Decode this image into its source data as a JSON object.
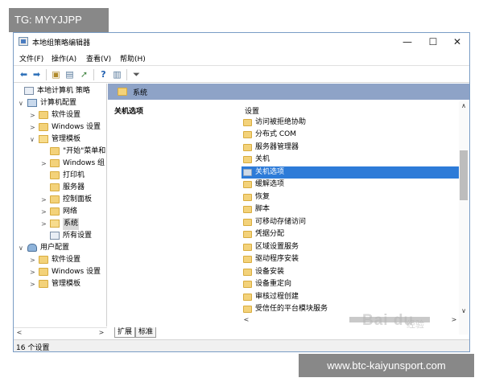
{
  "overlay": {
    "tg_label": "TG: MYYJJPP",
    "url_label": "www.btc-kaiyunsport.com",
    "baidu_mark": "Bai du",
    "baidu_sub": "经验"
  },
  "window": {
    "title": "本地组策略编辑器",
    "controls": {
      "minimize": "—",
      "maximize": "☐",
      "close": "✕"
    }
  },
  "menu": [
    "文件(F)",
    "操作(A)",
    "查看(V)",
    "帮助(H)"
  ],
  "tree": [
    {
      "label": "本地计算机 策略",
      "icon": "policy-icon",
      "arrow": ""
    },
    {
      "label": "计算机配置",
      "icon": "computer-icon",
      "arrow": "∨"
    },
    {
      "label": "软件设置",
      "icon": "folder-icon",
      "arrow": ">"
    },
    {
      "label": "Windows 设置",
      "icon": "folder-icon",
      "arrow": ">"
    },
    {
      "label": "管理模板",
      "icon": "folder-icon",
      "arrow": "∨"
    },
    {
      "label": "\"开始\"菜单和",
      "icon": "folder-icon",
      "arrow": ""
    },
    {
      "label": "Windows 组",
      "icon": "folder-icon",
      "arrow": ">"
    },
    {
      "label": "打印机",
      "icon": "folder-icon",
      "arrow": ""
    },
    {
      "label": "服务器",
      "icon": "folder-icon",
      "arrow": ""
    },
    {
      "label": "控制面板",
      "icon": "folder-icon",
      "arrow": ">"
    },
    {
      "label": "网络",
      "icon": "folder-icon",
      "arrow": ">"
    },
    {
      "label": "系统",
      "icon": "folder-open-icon",
      "arrow": ">"
    },
    {
      "label": "所有设置",
      "icon": "policy-icon",
      "arrow": ""
    },
    {
      "label": "用户配置",
      "icon": "user-icon",
      "arrow": "∨"
    },
    {
      "label": "软件设置",
      "icon": "folder-icon",
      "arrow": ">"
    },
    {
      "label": "Windows 设置",
      "icon": "folder-icon",
      "arrow": ">"
    },
    {
      "label": "管理模板",
      "icon": "folder-icon",
      "arrow": ">"
    }
  ],
  "right": {
    "header": "系统",
    "description_title": "关机选项",
    "list_header": "设置",
    "items": [
      "访问被拒绝协助",
      "分布式 COM",
      "服务器管理器",
      "关机",
      "关机选项",
      "缓解选项",
      "恢复",
      "脚本",
      "可移动存储访问",
      "凭据分配",
      "区域设置服务",
      "驱动程序安装",
      "设备安装",
      "设备重定向",
      "审核过程创建",
      "受信任的平台模块服务"
    ]
  },
  "tabs": [
    "扩展",
    "标准"
  ],
  "status": "16 个设置"
}
